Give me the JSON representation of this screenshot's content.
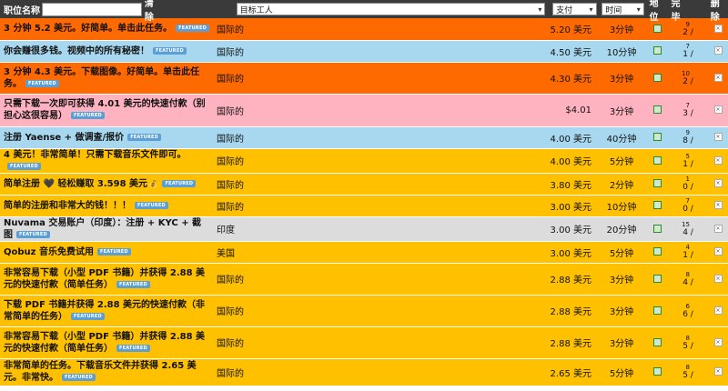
{
  "header": {
    "title_label": "职位名称",
    "title_input_value": "",
    "clear_label": "清除",
    "target_select": "目标工人",
    "pay_select": "支付",
    "time_select": "时间",
    "status_label": "地位",
    "complete_label": "完毕",
    "delete_label": "删除"
  },
  "featured_label": "FEATURED",
  "colors": {
    "orange": "#ff6a00",
    "blue": "#a8d8f0",
    "pink": "#ffb3c1",
    "yellow": "#ffc000",
    "gray": "#dcdcdc"
  },
  "rows": [
    {
      "title": "3 分钟 5.2 美元。好简单。单击此任务。",
      "target": "国际的",
      "pay": "5.20 美元",
      "time": "3分钟",
      "done": "2 /",
      "total": "9",
      "color": "orange",
      "height": 24
    },
    {
      "title": "你会赚很多钱。视频中的所有秘密！",
      "target": "国际的",
      "pay": "4.50 美元",
      "time": "10分钟",
      "done": "1 /",
      "total": "7",
      "color": "blue",
      "height": 24
    },
    {
      "title": "3 分钟 4.3 美元。下载图像。好简单。单击此任务。",
      "target": "国际的",
      "pay": "4.30 美元",
      "time": "3分钟",
      "done": "2 /",
      "total": "10",
      "color": "orange",
      "height": 35
    },
    {
      "title": "只需下载一次即可获得 4.01 美元的快速付款（别担心这很容易）",
      "target": "国际的",
      "pay": "$4.01",
      "time": "3分钟",
      "done": "3 /",
      "total": "7",
      "color": "pink",
      "height": 36
    },
    {
      "title": "注册 Yaense + 做调查/报价",
      "target": "国际的",
      "pay": "4.00 美元",
      "time": "40分钟",
      "done": "8 /",
      "total": "9",
      "color": "blue",
      "height": 24
    },
    {
      "title": "4 美元！非常简单！只需下载音乐文件即可。",
      "target": "国际的",
      "pay": "4.00 美元",
      "time": "5分钟",
      "done": "1 /",
      "total": "5",
      "color": "yellow",
      "height": 24
    },
    {
      "title": "简单注册 🖤 轻松赚取 3.598 美元💰",
      "target": "国际的",
      "pay": "3.80 美元",
      "time": "2分钟",
      "done": "0 /",
      "total": "1",
      "color": "yellow",
      "height": 24
    },
    {
      "title": "简单的注册和非常大的钱！！！",
      "target": "国际的",
      "pay": "3.00 美元",
      "time": "10分钟",
      "done": "0 /",
      "total": "7",
      "color": "yellow",
      "height": 24
    },
    {
      "title": "Nuvama 交易账户（印度）：注册 + KYC + 截图",
      "target": "印度",
      "pay": "3.00 美元",
      "time": "20分钟",
      "done": "4 /",
      "total": "15",
      "color": "gray",
      "height": 26,
      "normal": true
    },
    {
      "title": "Qobuz 音乐免费试用",
      "target": "美国",
      "pay": "3.00 美元",
      "time": "5分钟",
      "done": "1 /",
      "total": "4",
      "color": "yellow",
      "height": 24
    },
    {
      "title": "非常容易下载（小型 PDF 书籍）并获得 2.88 美元的快速付款（简单任务）",
      "target": "国际的",
      "pay": "2.88 美元",
      "time": "3分钟",
      "done": "4 /",
      "total": "8",
      "color": "yellow",
      "height": 35
    },
    {
      "title": "下载 PDF 书籍并获得 2.88 美元的快速付款（非常简单的任务）",
      "target": "国际的",
      "pay": "2.88 美元",
      "time": "3分钟",
      "done": "6 /",
      "total": "6",
      "color": "yellow",
      "height": 35
    },
    {
      "title": "非常容易下载（小型 PDF 书籍）并获得 2.88 美元的快速付款（简单任务）",
      "target": "国际的",
      "pay": "2.88 美元",
      "time": "3分钟",
      "done": "5 /",
      "total": "8",
      "color": "yellow",
      "height": 35
    },
    {
      "title": "非常简单的任务。下载音乐文件并获得 2.65 美元。非常快。",
      "target": "国际的",
      "pay": "2.65 美元",
      "time": "5分钟",
      "done": "5 /",
      "total": "8",
      "color": "yellow",
      "height": 30
    }
  ]
}
